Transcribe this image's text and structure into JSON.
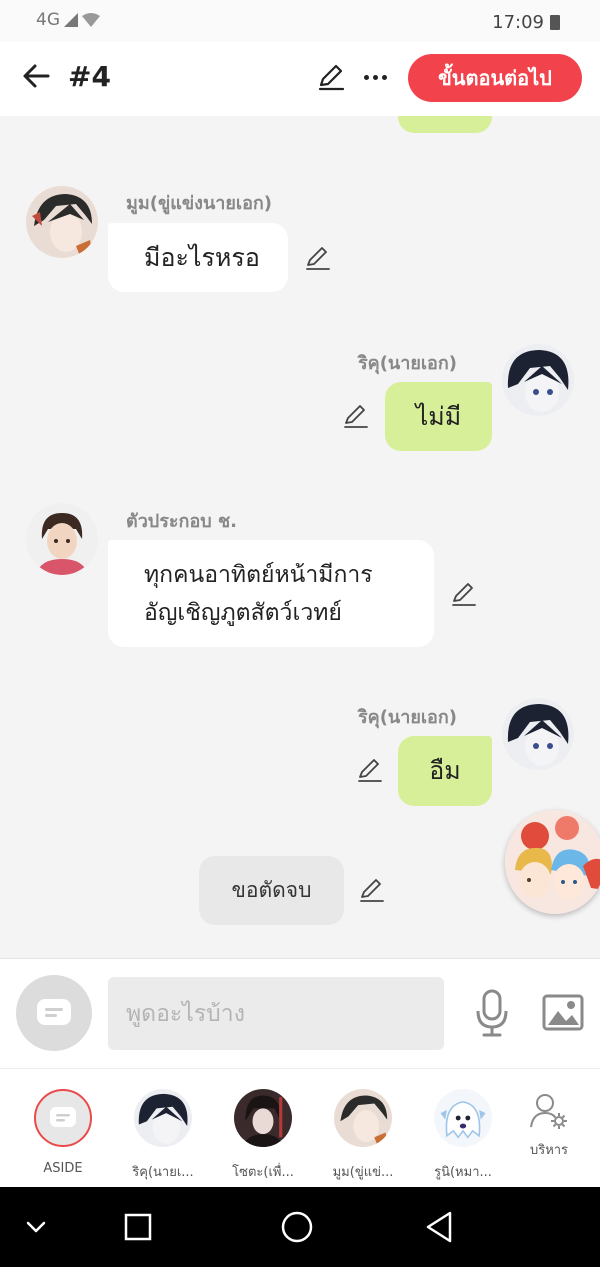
{
  "status_bar": {
    "network": "4G",
    "time": "17:09"
  },
  "header": {
    "title": "#4",
    "next_label": "ขั้นตอนต่อไป"
  },
  "messages": [
    {
      "side": "left",
      "name": "มูม(ขู่แข่งนายเอก)",
      "text": "มีอะไรหรอ"
    },
    {
      "side": "right",
      "name": "ริคุ(นายเอก)",
      "text": "ไม่มี"
    },
    {
      "side": "left",
      "name": "ตัวประกอบ ช.",
      "text": "ทุกคนอาทิตย์หน้ามีการ\nอัญเชิญภูตสัตว์เวทย์"
    },
    {
      "side": "right",
      "name": "ริคุ(นายเอก)",
      "text": "อืม"
    },
    {
      "side": "aside",
      "text": "ขอตัดจบ"
    }
  ],
  "composer": {
    "placeholder": "พูดอะไรบ้าง"
  },
  "cast": [
    {
      "label": "ASIDE"
    },
    {
      "label": "ริคุ(นายเ..."
    },
    {
      "label": "โซตะ(เพื่..."
    },
    {
      "label": "มูม(ขู่แข่..."
    },
    {
      "label": "รูนิ(หมา..."
    },
    {
      "label": "บริหาร"
    }
  ],
  "colors": {
    "accent": "#f2434d",
    "my_bubble": "#d8ef9a",
    "other_bubble": "#ffffff",
    "aside_bubble": "#e8e8e8"
  },
  "icons": {
    "back": "arrow-left-icon",
    "edit": "pencil-icon",
    "more": "more-horizontal-icon",
    "aside": "chat-bubble-icon",
    "mic": "microphone-icon",
    "image": "image-icon",
    "manage": "user-gear-icon",
    "nav": [
      "chevron-down-icon",
      "square-icon",
      "circle-icon",
      "triangle-back-icon"
    ]
  }
}
